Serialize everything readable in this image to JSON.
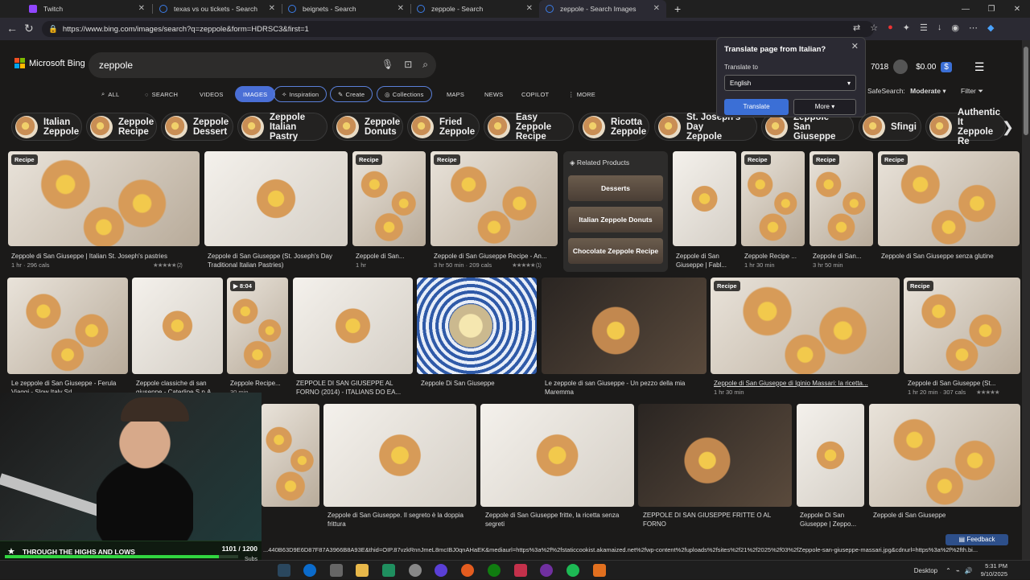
{
  "tabs": [
    {
      "label": "Twitch",
      "color": "#9146ff"
    },
    {
      "label": "texas vs ou tickets - Search",
      "color": "#3b7de9"
    },
    {
      "label": "beignets - Search",
      "color": "#3b7de9"
    },
    {
      "label": "zeppole - Search",
      "color": "#3b7de9"
    },
    {
      "label": "zeppole - Search Images",
      "color": "#3b7de9"
    }
  ],
  "new_tab": "+",
  "address": {
    "url": "https://www.bing.com/images/search?q=zeppole&form=HDRSC3&first=1"
  },
  "bing": {
    "brand": "Microsoft Bing",
    "query": "zeppole",
    "points": "7018",
    "wallet": "$0.00",
    "safesearch_label": "SafeSearch:",
    "safesearch_value": "Moderate",
    "filter": "Filter"
  },
  "nav": [
    {
      "label": "ALL",
      "icon": "search-icon"
    },
    {
      "label": "SEARCH",
      "icon": "chat-icon"
    },
    {
      "label": "VIDEOS"
    },
    {
      "label": "IMAGES"
    },
    {
      "label": "Inspiration"
    },
    {
      "label": "Create"
    },
    {
      "label": "Collections"
    },
    {
      "label": "MAPS"
    },
    {
      "label": "NEWS"
    },
    {
      "label": "COPILOT"
    },
    {
      "label": "MORE"
    }
  ],
  "chips": [
    {
      "l1": "Italian",
      "l2": "Zeppole"
    },
    {
      "l1": "Zeppole",
      "l2": "Recipe"
    },
    {
      "l1": "Zeppole",
      "l2": "Dessert"
    },
    {
      "l1": "Zeppole",
      "l2": "Italian Pastry"
    },
    {
      "l1": "Zeppole",
      "l2": "Donuts"
    },
    {
      "l1": "Fried",
      "l2": "Zeppole"
    },
    {
      "l1": "Easy Zeppole",
      "l2": "Recipe"
    },
    {
      "l1": "Ricotta",
      "l2": "Zeppole"
    },
    {
      "l1": "St. Joseph's Day",
      "l2": "Zeppole"
    },
    {
      "l1": "Zeppole",
      "l2": "San Giuseppe"
    },
    {
      "l1": "Sfingi",
      "l2": ""
    },
    {
      "l1": "Authentic It",
      "l2": "Zeppole Re"
    }
  ],
  "translate": {
    "title": "Translate page from Italian?",
    "to_label": "Translate to",
    "language": "English",
    "translate_btn": "Translate",
    "more_btn": "More"
  },
  "related": {
    "title": "Related Products",
    "items": [
      "Desserts",
      "Italian Zeppole Donuts",
      "Chocolate Zeppole Recipe"
    ]
  },
  "badge_recipe": "Recipe",
  "row1": [
    {
      "caption": "Zeppole di San Giuseppe | Italian St. Joseph's pastries",
      "meta": "1 hr · 296 cals",
      "rating": "★★★★★ (2)"
    },
    {
      "caption": "Zeppole di San Giuseppe (St. Joseph's Day Traditional Italian Pastries)",
      "meta": ""
    },
    {
      "caption": "Zeppole di San...",
      "meta": "1 hr"
    },
    {
      "caption": "Zeppole di San Giuseppe Recipe - An...",
      "meta": "3 hr 50 min · 209 cals",
      "rating": "★★★★★ (1)"
    },
    {
      "caption": "Zeppole di San Giuseppe | Fabl...",
      "meta": ""
    },
    {
      "caption": "Zeppole Recipe ...",
      "meta": "1 hr 30 min"
    },
    {
      "caption": "Zeppole di San...",
      "meta": "3 hr 50 min"
    },
    {
      "caption": "Zeppole di San Giuseppe senza glutine",
      "meta": ""
    }
  ],
  "row2": [
    {
      "caption": "Le zeppole di San Giuseppe - Ferula Viaggi - Slow Italy Srl"
    },
    {
      "caption": "Zeppole classiche di san giuseppe - Caterline S.p.A."
    },
    {
      "caption": "Zeppole Recipe...",
      "meta": "30 min",
      "video": "8:04"
    },
    {
      "caption": "ZEPPOLE DI SAN GIUSEPPE AL FORNO (2014) - ITALIANS DO EA..."
    },
    {
      "caption": "Zeppole Di San Giuseppe"
    },
    {
      "caption": "Le zeppole di san Giuseppe - Un pezzo della mia Maremma"
    },
    {
      "caption": "Zeppole di San Giuseppe di Iginio Massari: la ricetta...",
      "meta": "1 hr 30 min"
    },
    {
      "caption": "Zeppole di San Giuseppe (St...",
      "meta": "1 hr 20 min · 307 cals",
      "rating": "★★★★★"
    }
  ],
  "row3": [
    {
      "caption": "Zeppole di San Giuseppe. Il segreto è la doppia frittura"
    },
    {
      "caption": "Zeppole di San Giuseppe fritte, la ricetta senza segreti"
    },
    {
      "caption": "ZEPPOLE DI SAN GIUSEPPE FRITTE O AL FORNO"
    },
    {
      "caption": "Zeppole Di San Giuseppe | Zeppo..."
    },
    {
      "caption": "Zeppole di San Giuseppe"
    }
  ],
  "status_url": "...440B63D9E6D87F87A3966B8A93E&thid=OIP.87vzkRnnJmeL8mcIBJ0qnAHaEK&mediaurl=https%3a%2f%2fstaticcookist.akamaized.net%2fwp-content%2fuploads%2fsites%2f21%2f2025%2f03%2fZeppole-san-giuseppe-massari.jpg&cdnurl=https%3a%2f%2fth.bi...",
  "feedback": "Feedback",
  "overlay": {
    "goal_name": "THROUGH THE HIGHS AND LOWS",
    "goal_count": "1101 / 1200",
    "goal_unit": "Subs",
    "progress": 0.9175
  },
  "taskbar": {
    "desktop": "Desktop",
    "time": "5:31 PM",
    "date": "9/10/2025"
  },
  "colors": {
    "accent": "#4a6fd6",
    "page_bg": "#1b1a19",
    "goal_green": "#31d640"
  }
}
